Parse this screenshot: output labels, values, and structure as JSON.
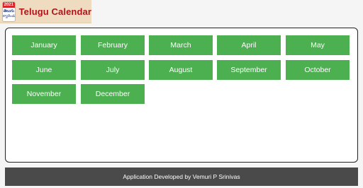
{
  "header": {
    "logo_year": "2021",
    "logo_text_line1": "తెలుగు",
    "logo_text_line2": "క్యాలెండర్",
    "title": "Telugu Calendar"
  },
  "months": [
    {
      "label": "January"
    },
    {
      "label": "February"
    },
    {
      "label": "March"
    },
    {
      "label": "April"
    },
    {
      "label": "May"
    },
    {
      "label": "June"
    },
    {
      "label": "July"
    },
    {
      "label": "August"
    },
    {
      "label": "September"
    },
    {
      "label": "October"
    },
    {
      "label": "November"
    },
    {
      "label": "December"
    }
  ],
  "footer": {
    "text": "Application Developed by Vemuri P Srinivas"
  },
  "colors": {
    "button": "#4caf50",
    "footer": "#4a4a4a",
    "title": "#b0141a"
  }
}
